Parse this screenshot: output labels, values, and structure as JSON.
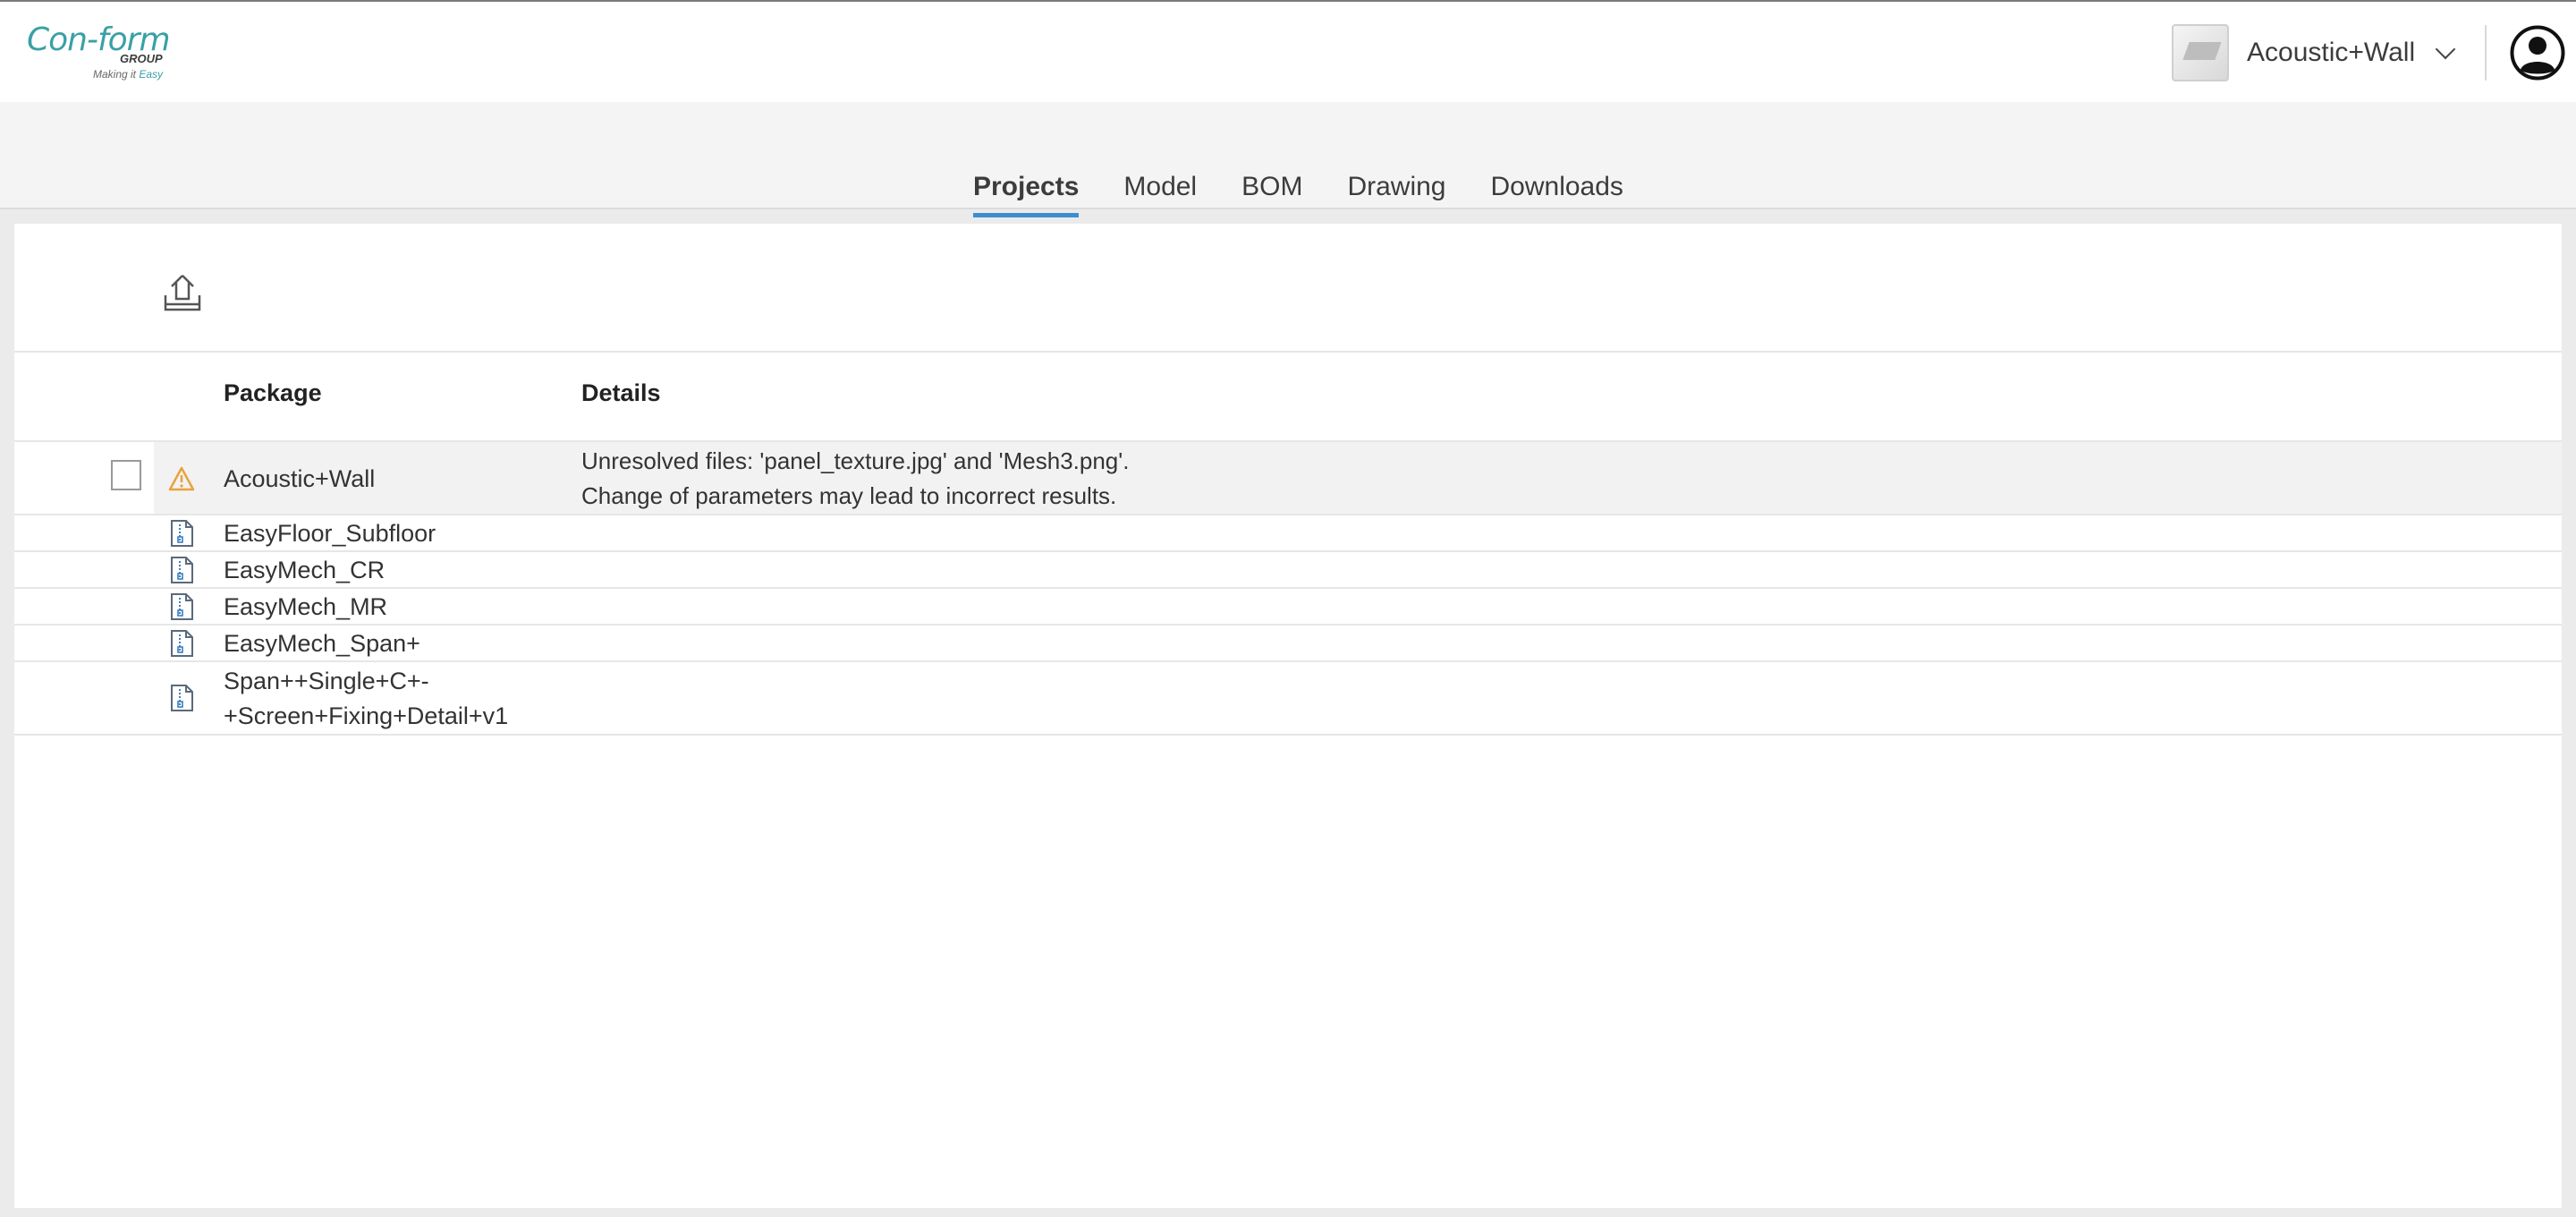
{
  "header": {
    "logo": {
      "main": "Con-form",
      "group": "GROUP",
      "tagline_prefix": "Making it ",
      "tagline_accent": "Easy"
    },
    "project_selector": {
      "name": "Acoustic+Wall",
      "thumbnail_icon": "project-thumbnail"
    },
    "user_icon": "user-avatar-icon"
  },
  "tabs": [
    {
      "label": "Projects",
      "active": true
    },
    {
      "label": "Model",
      "active": false
    },
    {
      "label": "BOM",
      "active": false
    },
    {
      "label": "Drawing",
      "active": false
    },
    {
      "label": "Downloads",
      "active": false
    }
  ],
  "toolbar": {
    "upload_icon": "upload-icon"
  },
  "table": {
    "columns": {
      "package": "Package",
      "details": "Details"
    },
    "rows": [
      {
        "package": "Acoustic+Wall",
        "icon": "warning-icon",
        "details_line1": "Unresolved files: 'panel_texture.jpg' and 'Mesh3.png'.",
        "details_line2": "Change of parameters may lead to incorrect results.",
        "selected": true,
        "checked": false
      },
      {
        "package": "EasyFloor_Subfloor",
        "icon": "zip-file-icon"
      },
      {
        "package": "EasyMech_CR",
        "icon": "zip-file-icon"
      },
      {
        "package": "EasyMech_MR",
        "icon": "zip-file-icon"
      },
      {
        "package": "EasyMech_Span+",
        "icon": "zip-file-icon"
      },
      {
        "package_line1": "Span++Single+C+-",
        "package_line2": "+Screen+Fixing+Detail+v1",
        "icon": "zip-file-icon"
      }
    ]
  },
  "colors": {
    "accent": "#3b8fd1",
    "brand": "#3aa0a6",
    "warning": "#e8a33c"
  }
}
